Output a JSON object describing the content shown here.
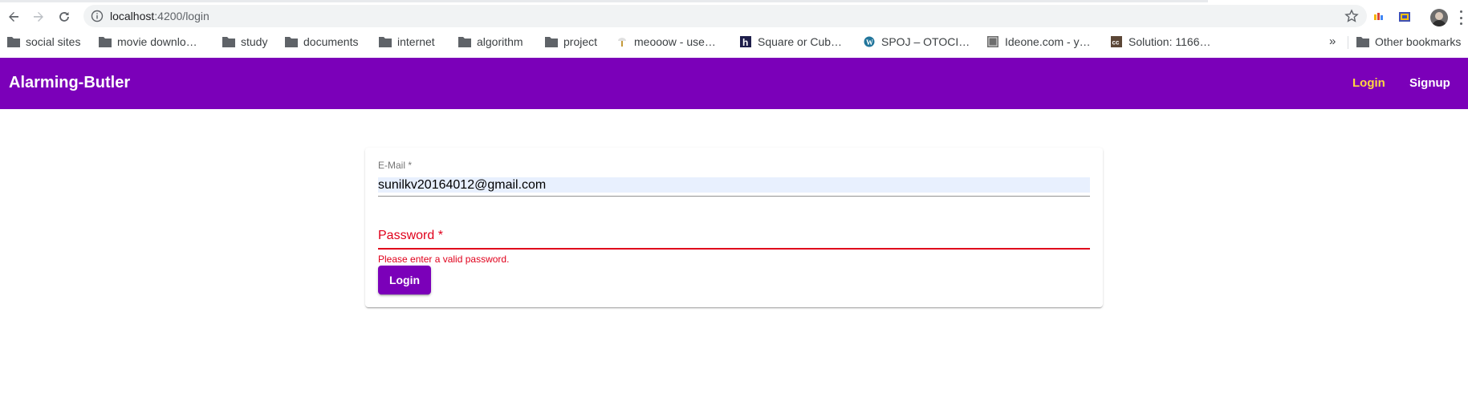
{
  "browser": {
    "url_host": "localhost",
    "url_path": ":4200/login",
    "bookmarks": [
      {
        "label": "social sites",
        "icon": "folder-icon"
      },
      {
        "label": "movie downlo…",
        "icon": "folder-icon"
      },
      {
        "label": "study",
        "icon": "folder-icon"
      },
      {
        "label": "documents",
        "icon": "folder-icon"
      },
      {
        "label": "internet",
        "icon": "folder-icon"
      },
      {
        "label": "algorithm",
        "icon": "folder-icon"
      },
      {
        "label": "project",
        "icon": "folder-icon"
      },
      {
        "label": "meooow - use…",
        "icon": "site-favicon"
      },
      {
        "label": "Square or Cub…",
        "icon": "h-favicon"
      },
      {
        "label": "SPOJ – OTOCI…",
        "icon": "wordpress-icon"
      },
      {
        "label": "Ideone.com - y…",
        "icon": "ideone-icon"
      },
      {
        "label": "Solution: 1166…",
        "icon": "cc-icon"
      }
    ],
    "overflow_label": "»",
    "other_bookmarks": "Other bookmarks"
  },
  "app": {
    "title": "Alarming-Butler",
    "nav": {
      "login": "Login",
      "signup": "Signup"
    },
    "colors": {
      "primary": "#7b00b9",
      "accent": "#ffd740",
      "error": "#e0001b"
    }
  },
  "form": {
    "email_label": "E-Mail *",
    "email_value": "sunilkv20164012@gmail.com",
    "password_label": "Password *",
    "password_error": "Please enter a valid password.",
    "submit_label": "Login"
  }
}
